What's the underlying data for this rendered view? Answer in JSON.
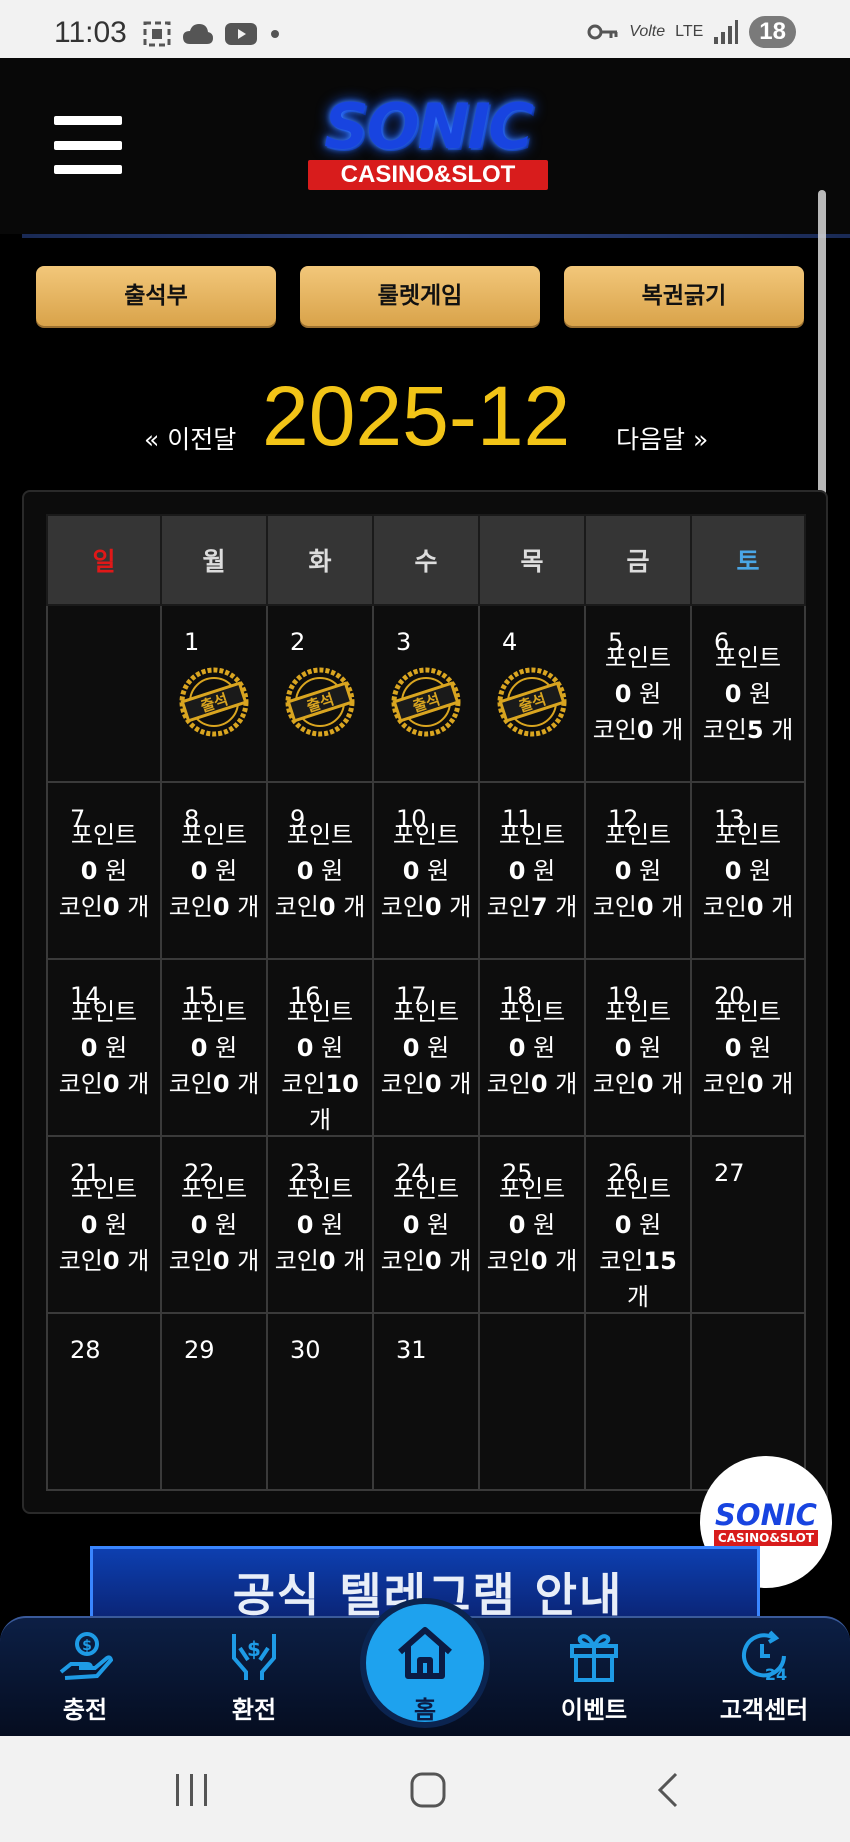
{
  "status_bar": {
    "time": "11:03",
    "volte": "Volte",
    "lte": "LTE",
    "battery": "18"
  },
  "header": {
    "logo_main": "SONIC",
    "logo_sub": "CASINO&SLOT"
  },
  "buttons": {
    "attendance": "출석부",
    "roulette": "룰렛게임",
    "lottery": "복권긁기"
  },
  "month_nav": {
    "prev": "« 이전달",
    "title": "2025-12",
    "next": "다음달 »"
  },
  "calendar": {
    "weekdays": [
      "일",
      "월",
      "화",
      "수",
      "목",
      "금",
      "토"
    ],
    "stamp_label": "출석",
    "weeks": [
      [
        {
          "day": ""
        },
        {
          "day": "1",
          "stamp": true
        },
        {
          "day": "2",
          "stamp": true
        },
        {
          "day": "3",
          "stamp": true
        },
        {
          "day": "4",
          "stamp": true
        },
        {
          "day": "5",
          "point": "0",
          "coin": "0"
        },
        {
          "day": "6",
          "point": "0",
          "coin": "5"
        }
      ],
      [
        {
          "day": "7",
          "point": "0",
          "coin": "0"
        },
        {
          "day": "8",
          "point": "0",
          "coin": "0"
        },
        {
          "day": "9",
          "point": "0",
          "coin": "0"
        },
        {
          "day": "10",
          "point": "0",
          "coin": "0"
        },
        {
          "day": "11",
          "point": "0",
          "coin": "7"
        },
        {
          "day": "12",
          "point": "0",
          "coin": "0"
        },
        {
          "day": "13",
          "point": "0",
          "coin": "0"
        }
      ],
      [
        {
          "day": "14",
          "point": "0",
          "coin": "0"
        },
        {
          "day": "15",
          "point": "0",
          "coin": "0"
        },
        {
          "day": "16",
          "point": "0",
          "coin": "10"
        },
        {
          "day": "17",
          "point": "0",
          "coin": "0"
        },
        {
          "day": "18",
          "point": "0",
          "coin": "0"
        },
        {
          "day": "19",
          "point": "0",
          "coin": "0"
        },
        {
          "day": "20",
          "point": "0",
          "coin": "0"
        }
      ],
      [
        {
          "day": "21",
          "point": "0",
          "coin": "0"
        },
        {
          "day": "22",
          "point": "0",
          "coin": "0"
        },
        {
          "day": "23",
          "point": "0",
          "coin": "0"
        },
        {
          "day": "24",
          "point": "0",
          "coin": "0"
        },
        {
          "day": "25",
          "point": "0",
          "coin": "0"
        },
        {
          "day": "26",
          "point": "0",
          "coin": "15"
        },
        {
          "day": "27"
        }
      ],
      [
        {
          "day": "28"
        },
        {
          "day": "29"
        },
        {
          "day": "30"
        },
        {
          "day": "31"
        },
        {
          "day": ""
        },
        {
          "day": ""
        },
        {
          "day": ""
        }
      ]
    ],
    "labels": {
      "point": "포인트",
      "won": "원",
      "coin": "코인",
      "count": "개"
    }
  },
  "float_logo": {
    "main": "SONIC",
    "sub": "CASINO&SLOT"
  },
  "banner": {
    "text": "공식 텔레그램 안내"
  },
  "bottom_nav": {
    "items": [
      {
        "label": "충전",
        "icon": "deposit-icon"
      },
      {
        "label": "환전",
        "icon": "withdraw-icon"
      },
      {
        "label": "홈",
        "icon": "home-icon"
      },
      {
        "label": "이벤트",
        "icon": "gift-icon"
      },
      {
        "label": "고객센터",
        "icon": "support-24-icon"
      }
    ]
  },
  "colors": {
    "gold": "#f2c417",
    "button": "#e8b865",
    "sunday": "#e01818",
    "saturday": "#4aa6e6",
    "nav_blue": "#1ea2ee"
  }
}
